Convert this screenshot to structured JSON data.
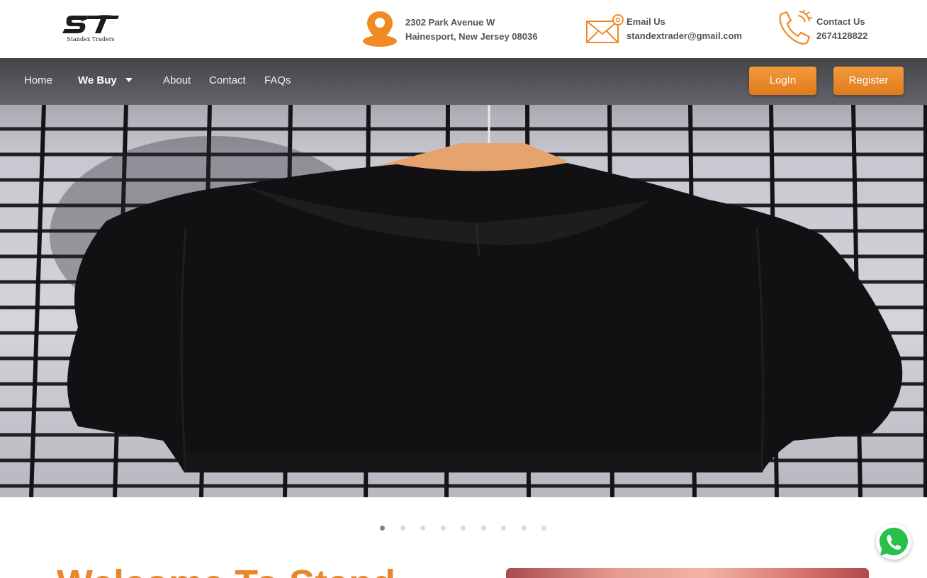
{
  "brand": {
    "logo_text": "Standex Traders",
    "accent_color": "#f08a24"
  },
  "contact_bar": {
    "address": {
      "icon": "location-pin-icon",
      "line1": "2302 Park Avenue W",
      "line2": "Hainesport, New Jersey 08036"
    },
    "email": {
      "icon": "envelope-icon",
      "title": "Email Us",
      "value": "standextrader@gmail.com"
    },
    "phone": {
      "icon": "phone-icon",
      "title": "Contact Us",
      "value": "2674128822"
    }
  },
  "nav": {
    "items": [
      {
        "label": "Home"
      },
      {
        "label": "We Buy",
        "has_dropdown": true
      },
      {
        "label": "About"
      },
      {
        "label": "Contact"
      },
      {
        "label": "FAQs"
      }
    ],
    "login_label": "LogIn",
    "register_label": "Register"
  },
  "carousel": {
    "slide_count": 9,
    "active_index": 0
  },
  "welcome": {
    "heading": "Welcome To Stand"
  },
  "floating": {
    "whatsapp_icon": "whatsapp-icon",
    "whatsapp_color": "#27c04a"
  }
}
